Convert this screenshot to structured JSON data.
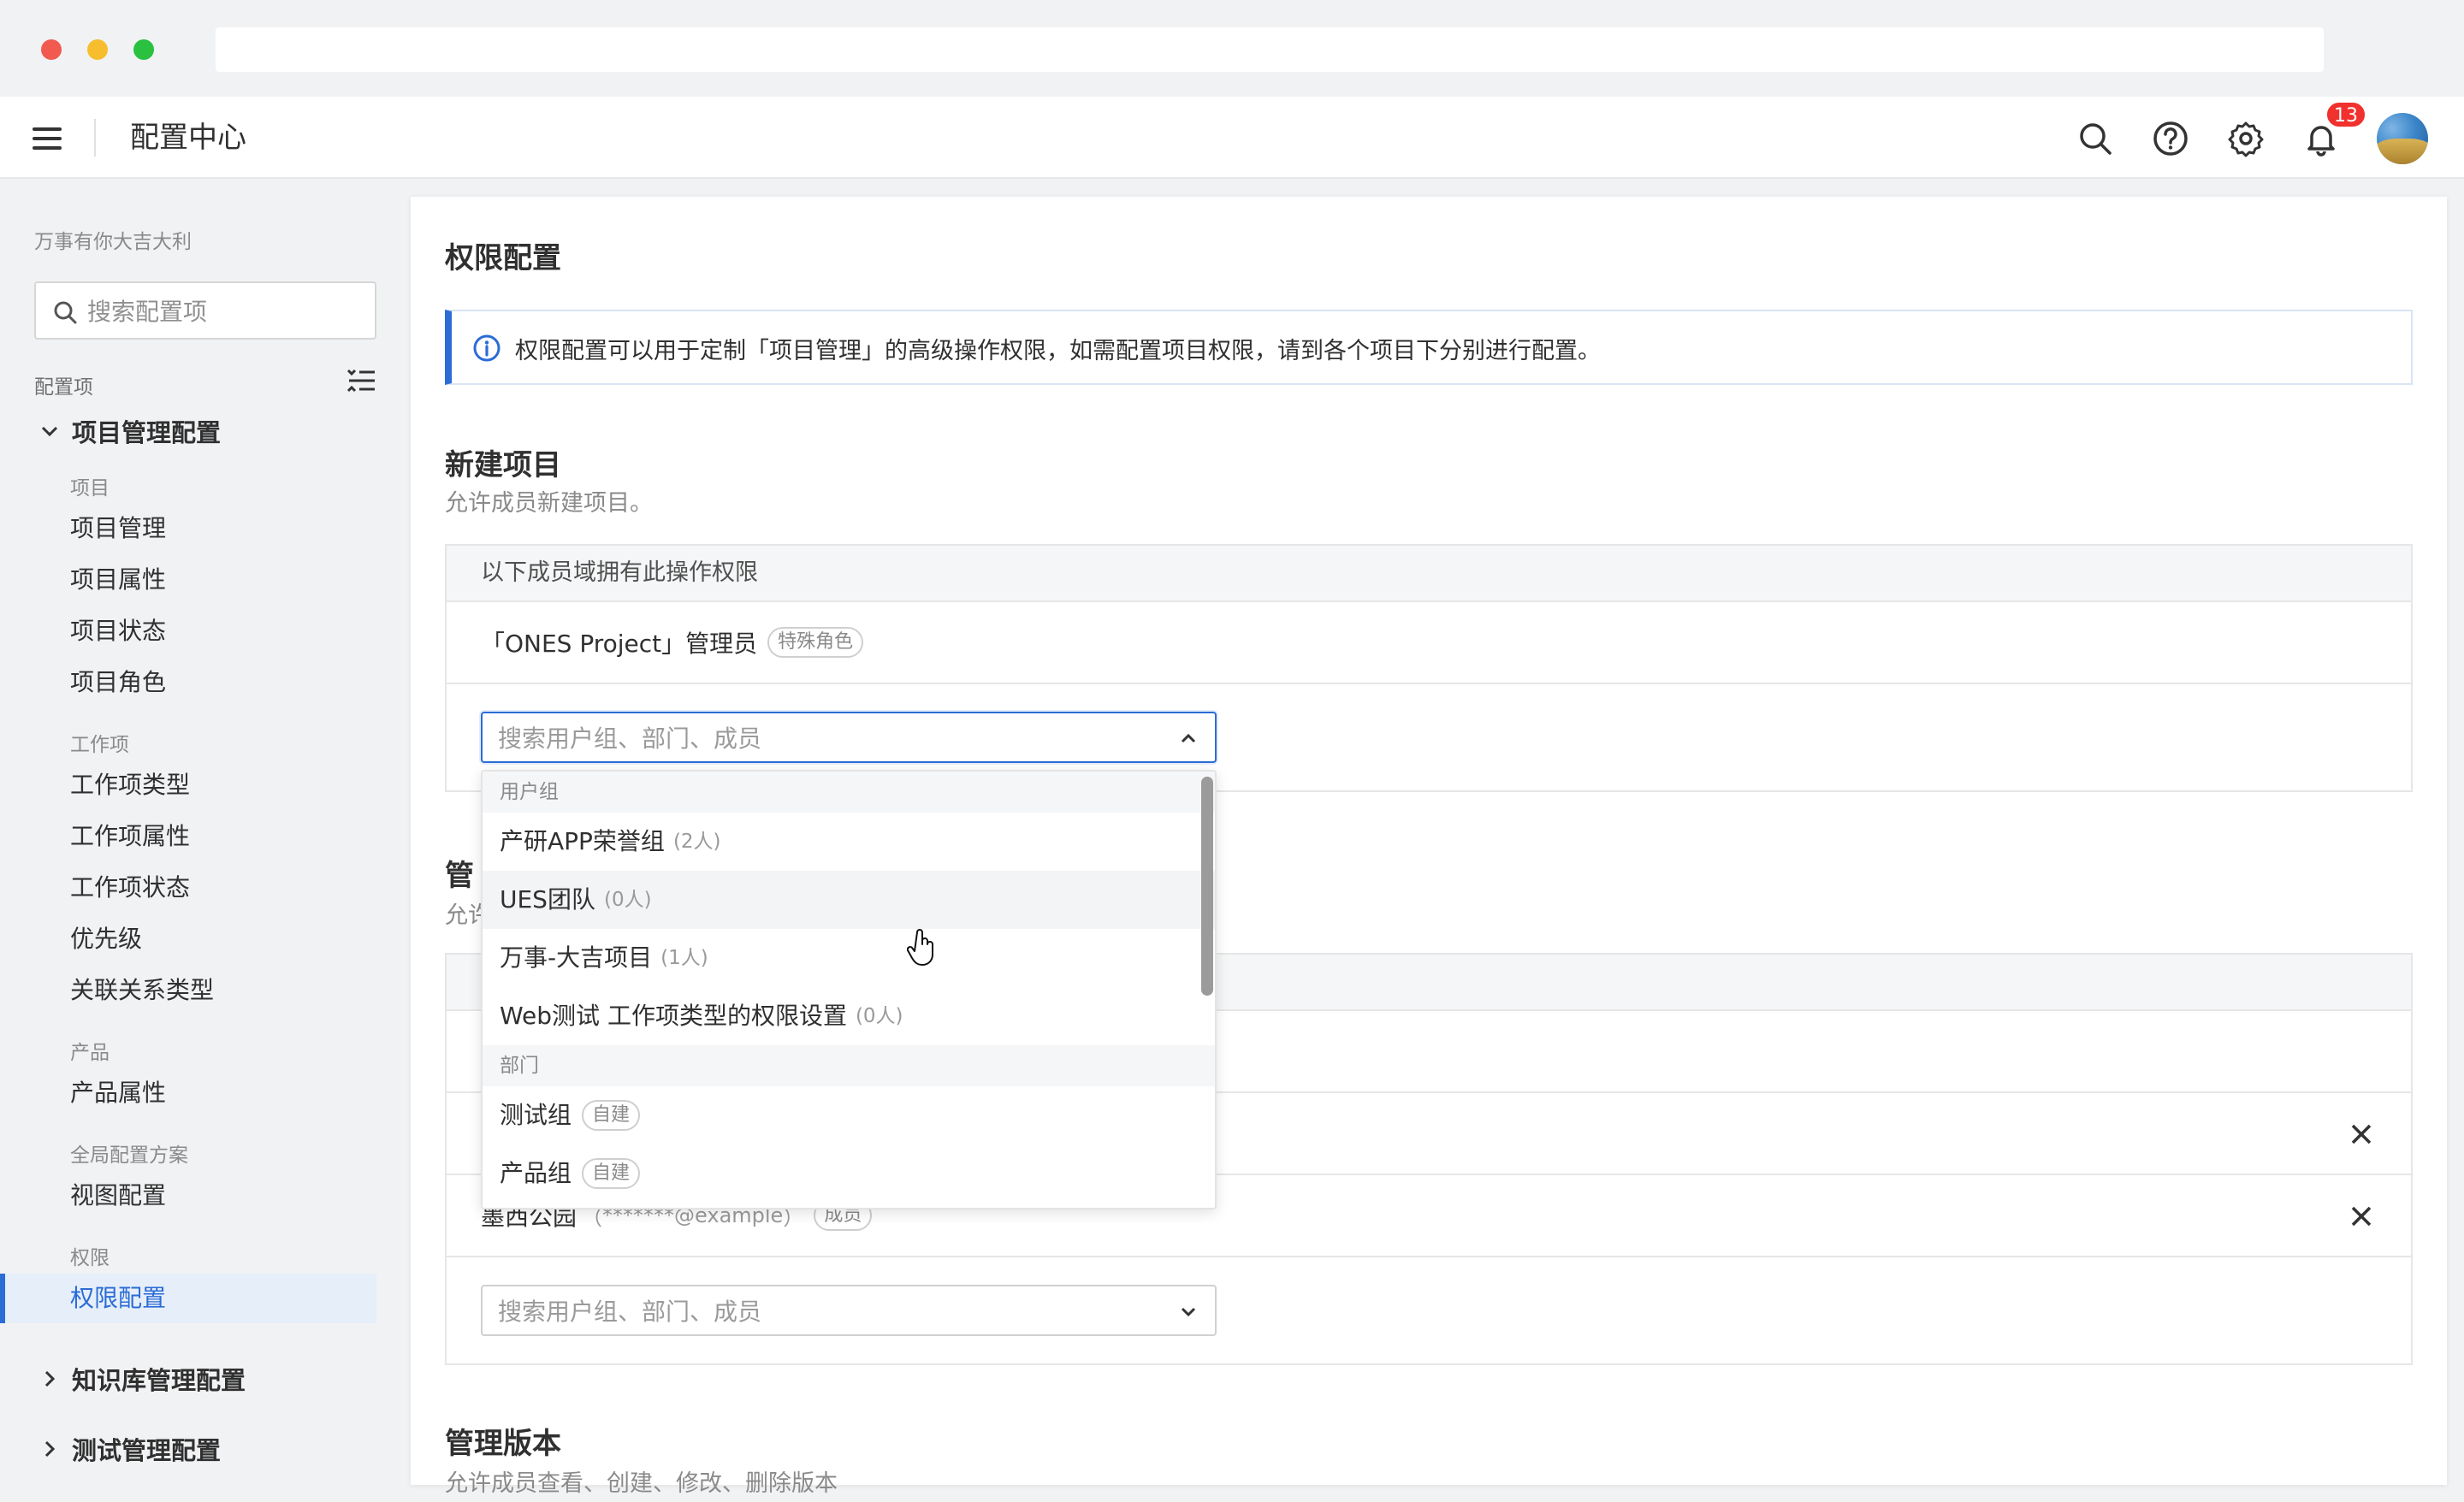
{
  "header": {
    "title": "配置中心",
    "notification_count": "13"
  },
  "sidebar": {
    "org_name": "万事有你大吉大利",
    "search_placeholder": "搜索配置项",
    "config_label": "配置项",
    "groups": [
      {
        "title": "项目管理配置",
        "expanded": true,
        "sections": [
          {
            "label": "项目",
            "items": [
              "项目管理",
              "项目属性",
              "项目状态",
              "项目角色"
            ]
          },
          {
            "label": "工作项",
            "items": [
              "工作项类型",
              "工作项属性",
              "工作项状态",
              "优先级",
              "关联关系类型"
            ]
          },
          {
            "label": "产品",
            "items": [
              "产品属性"
            ]
          },
          {
            "label": "全局配置方案",
            "items": [
              "视图配置"
            ]
          },
          {
            "label": "权限",
            "items": [
              "权限配置"
            ]
          }
        ]
      },
      {
        "title": "知识库管理配置",
        "expanded": false
      },
      {
        "title": "测试管理配置",
        "expanded": false
      }
    ],
    "active_item": "权限配置"
  },
  "main": {
    "page_title": "权限配置",
    "info_text": "权限配置可以用于定制「项目管理」的高级操作权限，如需配置项目权限，请到各个项目下分别进行配置。",
    "sections": [
      {
        "title": "新建项目",
        "desc": "允许成员新建项目。",
        "table_header": "以下成员域拥有此操作权限",
        "rows": [
          {
            "name": "「ONES Project」管理员",
            "tag": "特殊角色"
          }
        ],
        "select_placeholder": "搜索用户组、部门、成员"
      },
      {
        "title": "管",
        "desc": "允许",
        "rows": [
          {
            "name": "墨西公园",
            "email": "*******@example",
            "tag": "成员"
          }
        ],
        "select_placeholder": "搜索用户组、部门、成员"
      },
      {
        "title": "管理版本",
        "desc": "允许成员查看、创建、修改、删除版本"
      }
    ]
  },
  "dropdown": {
    "groups": [
      {
        "label": "用户组",
        "items": [
          {
            "name": "产研APP荣誉组",
            "count": "(2人)"
          },
          {
            "name": "UES团队",
            "count": "(0人)"
          },
          {
            "name": "万事-大吉项目",
            "count": "(1人)"
          },
          {
            "name": "Web测试 工作项类型的权限设置",
            "count": "(0人)"
          }
        ]
      },
      {
        "label": "部门",
        "items": [
          {
            "name": "测试组",
            "tag": "自建"
          },
          {
            "name": "产品组",
            "tag": "自建"
          }
        ]
      }
    ]
  },
  "colors": {
    "accent": "#2b6cd6",
    "badge": "#f0312d",
    "active_bg": "#e6eef9"
  }
}
